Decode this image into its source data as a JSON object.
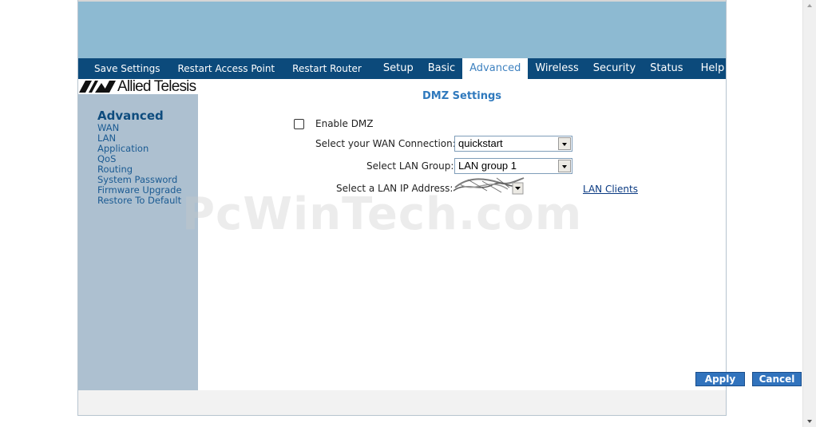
{
  "nav": {
    "items": [
      {
        "label": "Save Settings",
        "active": false
      },
      {
        "label": "Restart Access Point",
        "active": false
      },
      {
        "label": "Restart Router",
        "active": false
      },
      {
        "label": "Setup",
        "active": false
      },
      {
        "label": "Basic",
        "active": false
      },
      {
        "label": "Advanced",
        "active": true
      },
      {
        "label": "Wireless",
        "active": false
      },
      {
        "label": "Security",
        "active": false
      },
      {
        "label": "Status",
        "active": false
      },
      {
        "label": "Help",
        "active": false
      }
    ]
  },
  "brand": {
    "name": "Allied Telesis"
  },
  "sidebar": {
    "title": "Advanced",
    "links": [
      "WAN",
      "LAN",
      "Application",
      "QoS",
      "Routing",
      "System Password",
      "Firmware Upgrade",
      "Restore To Default"
    ]
  },
  "main": {
    "title": "DMZ Settings",
    "enable_dmz": {
      "label": "Enable DMZ",
      "checked": false
    },
    "wan_connection": {
      "label": "Select your WAN Connection:",
      "value": "quickstart"
    },
    "lan_group": {
      "label": "Select LAN Group:",
      "value": "LAN group 1"
    },
    "lan_ip": {
      "label": "Select a LAN IP Address:"
    },
    "lan_clients_link": "LAN Clients",
    "apply_button": "Apply",
    "cancel_button": "Cancel"
  },
  "watermark": "PcWinTech.com",
  "colors": {
    "nav_bg": "#0c4a7b",
    "banner_bg": "#8dbad2",
    "sidebar_bg": "#adc0d0",
    "button_bg": "#3173bd",
    "title_color": "#2f79bd"
  }
}
